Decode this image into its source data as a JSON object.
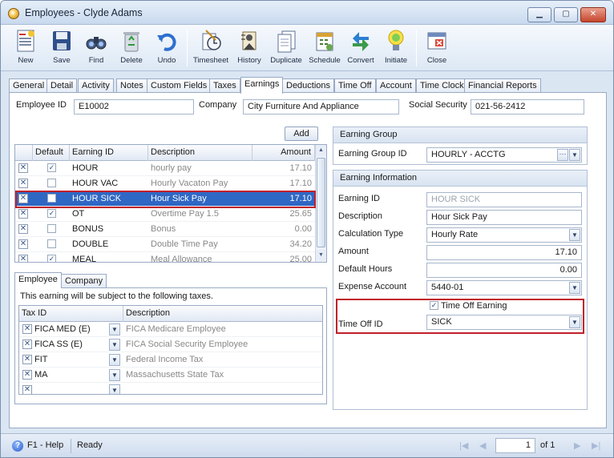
{
  "window": {
    "title": "Employees - Clyde Adams",
    "minimize_glyph": "▁",
    "maximize_glyph": "▢",
    "close_glyph": "✕"
  },
  "toolbar": [
    {
      "label": "New",
      "icon": "new-document-icon"
    },
    {
      "label": "Save",
      "icon": "floppy-disk-icon"
    },
    {
      "label": "Find",
      "icon": "binoculars-icon"
    },
    {
      "label": "Delete",
      "icon": "recycle-bin-icon"
    },
    {
      "label": "Undo",
      "icon": "undo-arrow-icon"
    },
    {
      "label": "Timesheet",
      "icon": "timesheet-icon"
    },
    {
      "label": "History",
      "icon": "history-icon"
    },
    {
      "label": "Duplicate",
      "icon": "duplicate-icon"
    },
    {
      "label": "Schedule",
      "icon": "schedule-icon"
    },
    {
      "label": "Convert",
      "icon": "convert-icon"
    },
    {
      "label": "Initiate",
      "icon": "initiate-icon"
    },
    {
      "label": "Close",
      "icon": "close-window-icon"
    }
  ],
  "tabs": [
    "General",
    "Detail",
    "Activity",
    "Notes",
    "Custom Fields",
    "Taxes",
    "Earnings",
    "Deductions",
    "Time Off",
    "Account",
    "Time Clock",
    "Financial Reports"
  ],
  "active_tab": "Earnings",
  "header": {
    "employee_id_label": "Employee ID",
    "employee_id": "E10002",
    "company_label": "Company",
    "company": "City Furniture And Appliance",
    "ssn_label": "Social Security",
    "ssn": "021-56-2412"
  },
  "earnings": {
    "add_label": "Add",
    "columns": [
      "Default",
      "Earning ID",
      "Description",
      "Amount"
    ],
    "x_glyph": "✕",
    "check_glyph": "✓",
    "rows": [
      {
        "default": true,
        "id": "HOUR",
        "description": "hourly pay",
        "amount": "17.10"
      },
      {
        "default": false,
        "id": "HOUR VAC",
        "description": "Hourly Vacaton Pay",
        "amount": "17.10"
      },
      {
        "default": false,
        "id": "HOUR SICK",
        "description": "Hour Sick Pay",
        "amount": "17.10",
        "selected": true
      },
      {
        "default": true,
        "id": "OT",
        "description": "Overtime Pay 1.5",
        "amount": "25.65"
      },
      {
        "default": false,
        "id": "BONUS",
        "description": "Bonus",
        "amount": "0.00"
      },
      {
        "default": false,
        "id": "DOUBLE",
        "description": "Double Time Pay",
        "amount": "34.20"
      },
      {
        "default": true,
        "id": "MEAL",
        "description": "Meal Allowance",
        "amount": "25.00"
      }
    ]
  },
  "subtabs": [
    "Employee",
    "Company"
  ],
  "taxes": {
    "caption": "This earning will be subject to the following taxes.",
    "columns": [
      "Tax ID",
      "Description"
    ],
    "rows": [
      {
        "id": "FICA MED (E)",
        "description": "FICA Medicare Employee"
      },
      {
        "id": "FICA SS (E)",
        "description": "FICA Social Security Employee"
      },
      {
        "id": "FIT",
        "description": "Federal Income Tax"
      },
      {
        "id": "MA",
        "description": "Massachusetts State Tax"
      },
      {
        "id": "",
        "description": ""
      }
    ]
  },
  "earning_group": {
    "title": "Earning Group",
    "id_label": "Earning Group ID",
    "id": "HOURLY - ACCTG",
    "dots_glyph": "···"
  },
  "earning_info": {
    "title": "Earning Information",
    "fields": [
      {
        "label": "Earning ID",
        "value": "HOUR SICK",
        "readonly": true
      },
      {
        "label": "Description",
        "value": "Hour Sick Pay"
      },
      {
        "label": "Calculation Type",
        "value": "Hourly Rate",
        "dropdown": true
      },
      {
        "label": "Amount",
        "value": "17.10",
        "numeric": true
      },
      {
        "label": "Default Hours",
        "value": "0.00",
        "numeric": true
      },
      {
        "label": "Expense Account",
        "value": "5440-01",
        "dropdown": true
      }
    ],
    "time_off_earning_label": "Time Off Earning",
    "time_off_earning": true,
    "time_off_id_label": "Time Off ID",
    "time_off_id": "SICK"
  },
  "status": {
    "help": "F1 - Help",
    "help_glyph": "?",
    "ready": "Ready",
    "page": "1",
    "of_label": "of 1",
    "first_glyph": "|◀",
    "prev_glyph": "◀",
    "next_glyph": "▶",
    "last_glyph": "▶|"
  }
}
